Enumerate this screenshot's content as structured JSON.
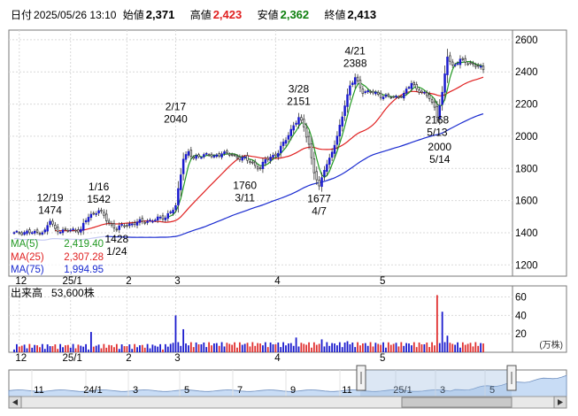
{
  "header": {
    "date_label": "日付",
    "date_value": "2025/05/26 13:10",
    "open_label": "始値",
    "open_value": "2,371",
    "high_label": "高値",
    "high_value": "2,423",
    "low_label": "安値",
    "low_value": "2,362",
    "close_label": "終値",
    "close_value": "2,413"
  },
  "colors": {
    "up": "#1a1acd",
    "down": "#e03030",
    "high": "#e02020",
    "low": "#108010",
    "ma5": "#229922",
    "ma25": "#e02020",
    "ma75": "#1a2bd0",
    "volume_up": "#1a1acd",
    "volume_down": "#e03030",
    "navigator_fill": "#c8dcf5"
  },
  "legend": {
    "ma5_label": "MA(5)",
    "ma5_value": "2,419.40",
    "ma25_label": "MA(25)",
    "ma25_value": "2,307.28",
    "ma75_label": "MA(75)",
    "ma75_value": "1,994.95"
  },
  "volume_panel": {
    "title": "出来高",
    "value": "53,600株",
    "unit": "(万株)"
  },
  "chart_data": [
    {
      "type": "candlestick",
      "x_tick_labels": [
        "12",
        "25/1",
        "2",
        "3",
        "4",
        "5"
      ],
      "y_ticks": [
        1200,
        1400,
        1600,
        1800,
        2000,
        2200,
        2400,
        2600
      ],
      "ylim": [
        1130,
        2660
      ],
      "series": [
        {
          "name": "MA(5)"
        },
        {
          "name": "MA(25)"
        },
        {
          "name": "MA(75)"
        }
      ],
      "annotations": [
        {
          "date": "12/19",
          "value": 1474,
          "position": "above"
        },
        {
          "date": "1/16",
          "value": 1542,
          "position": "above"
        },
        {
          "date": "1/24",
          "value": 1428,
          "position": "below"
        },
        {
          "date": "2/17",
          "value": 2040,
          "position": "above"
        },
        {
          "date": "3/11",
          "value": 1760,
          "position": "below"
        },
        {
          "date": "3/28",
          "value": 2151,
          "position": "above"
        },
        {
          "date": "4/7",
          "value": 1677,
          "position": "below"
        },
        {
          "date": "4/21",
          "value": 2388,
          "position": "above"
        },
        {
          "date": "5/13",
          "value": 2168,
          "position": "below"
        },
        {
          "date": "5/14",
          "value": 2000,
          "position": "below"
        }
      ]
    },
    {
      "type": "bar",
      "title": "出来高",
      "y_ticks": [
        20,
        40,
        60
      ],
      "ylim": [
        0,
        72
      ],
      "unit": "(万株)"
    },
    {
      "type": "area",
      "x_tick_labels": [
        "11",
        "24/1",
        "3",
        "5",
        "7",
        "9",
        "11",
        "25/1",
        "3",
        "5"
      ]
    }
  ]
}
